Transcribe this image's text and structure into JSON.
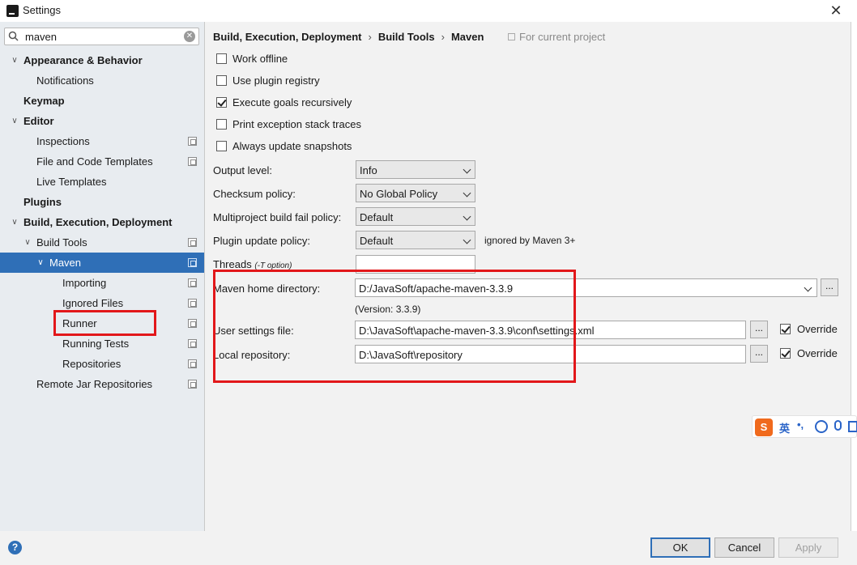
{
  "window": {
    "title": "Settings",
    "close_glyph": "✕"
  },
  "search": {
    "value": "maven",
    "clear_glyph": "✕"
  },
  "tree": [
    {
      "label": "Appearance & Behavior",
      "arrow": "∨",
      "bold": true
    },
    {
      "label": "Notifications"
    },
    {
      "label": "Keymap",
      "bold": true
    },
    {
      "label": "Editor",
      "arrow": "∨",
      "bold": true
    },
    {
      "label": "Inspections",
      "scope_icon": true
    },
    {
      "label": "File and Code Templates",
      "scope_icon": true
    },
    {
      "label": "Live Templates"
    },
    {
      "label": "Plugins",
      "bold": true
    },
    {
      "label": "Build, Execution, Deployment",
      "arrow": "∨",
      "bold": true
    },
    {
      "label": "Build Tools",
      "arrow": "∨",
      "scope_icon": true
    },
    {
      "label": "Maven",
      "arrow": "∨",
      "scope_icon": true,
      "selected": true
    },
    {
      "label": "Importing",
      "scope_icon": true
    },
    {
      "label": "Ignored Files",
      "scope_icon": true
    },
    {
      "label": "Runner",
      "scope_icon": true
    },
    {
      "label": "Running Tests",
      "scope_icon": true
    },
    {
      "label": "Repositories",
      "scope_icon": true
    },
    {
      "label": "Remote Jar Repositories",
      "scope_icon": true
    }
  ],
  "breadcrumb": {
    "part1": "Build, Execution, Deployment",
    "part2": "Build Tools",
    "part3": "Maven",
    "separator": "›",
    "scope_note": "For current project"
  },
  "checkboxes": [
    {
      "label": "Work offline",
      "checked": false
    },
    {
      "label": "Use plugin registry",
      "checked": false
    },
    {
      "label": "Execute goals recursively",
      "checked": true
    },
    {
      "label": "Print exception stack traces",
      "checked": false
    },
    {
      "label": "Always update snapshots",
      "checked": false
    }
  ],
  "form": {
    "output_level_label": "Output level:",
    "output_level_value": "Info",
    "checksum_label": "Checksum policy:",
    "checksum_value": "No Global Policy",
    "multiproject_label": "Multiproject build fail policy:",
    "multiproject_value": "Default",
    "plugin_update_label": "Plugin update policy:",
    "plugin_update_value": "Default",
    "plugin_update_note": "ignored by Maven 3+",
    "threads_label": "Threads",
    "threads_hint": "(-T option)",
    "threads_value": "",
    "maven_home_label": "Maven home directory:",
    "maven_home_value": "D:/JavaSoft/apache-maven-3.3.9",
    "maven_version": "(Version: 3.3.9)",
    "user_settings_label": "User settings file:",
    "user_settings_value": "D:\\JavaSoft\\apache-maven-3.3.9\\conf\\settings.xml",
    "local_repo_label": "Local repository:",
    "local_repo_value": "D:\\JavaSoft\\repository",
    "browse_label": "...",
    "override_label": "Override",
    "user_settings_override": true,
    "local_repo_override": true
  },
  "ime": {
    "logo": "S",
    "mode": "英",
    "punct": "•,"
  },
  "footer": {
    "help": "?",
    "ok": "OK",
    "cancel": "Cancel",
    "apply": "Apply"
  },
  "colors": {
    "selection": "#2f6fb7",
    "annotation_red": "#e2171a",
    "sidebar_bg": "#e8ecf0"
  }
}
